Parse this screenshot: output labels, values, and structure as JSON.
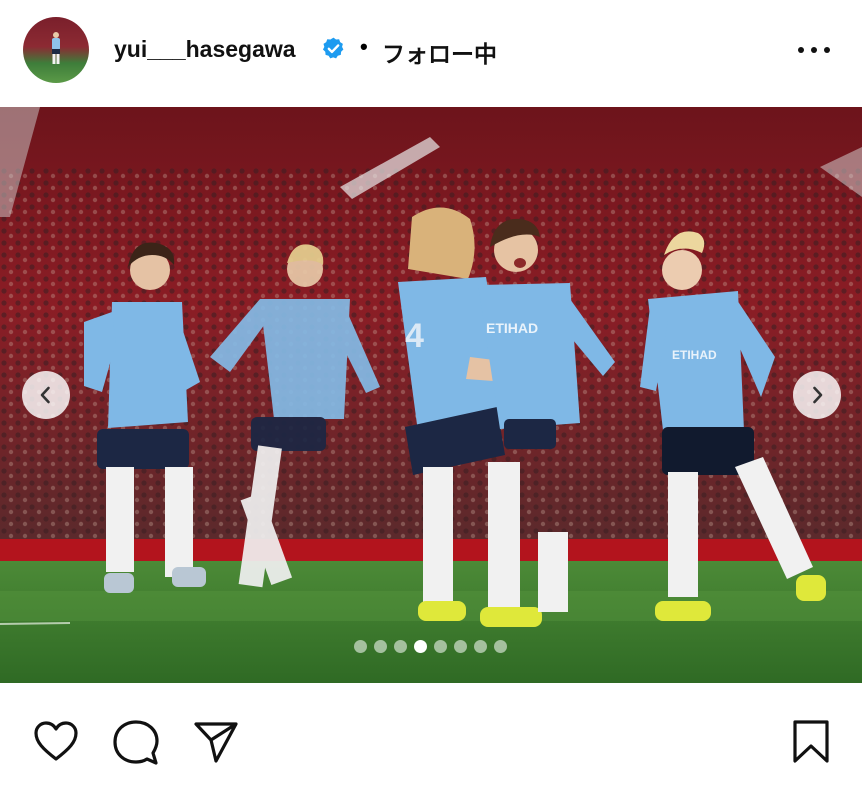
{
  "post": {
    "username": "yui___hasegawa",
    "verified": true,
    "separator": "•",
    "follow_status": "フォロー中"
  },
  "carousel": {
    "slide_count": 8,
    "active_index": 3
  },
  "photo": {
    "sponsor_text": "ETIHAD",
    "shirt_number": "4"
  },
  "colors": {
    "kit_sky_blue": "#7fb8e6",
    "verified_blue": "#1d9bf0",
    "pitch_green": "#3e7a2e",
    "crowd_red": "#8b1d25"
  },
  "icons": {
    "more": "more-options-icon",
    "prev": "chevron-left-icon",
    "next": "chevron-right-icon",
    "like": "heart-icon",
    "comment": "comment-icon",
    "share": "send-icon",
    "save": "bookmark-icon"
  }
}
